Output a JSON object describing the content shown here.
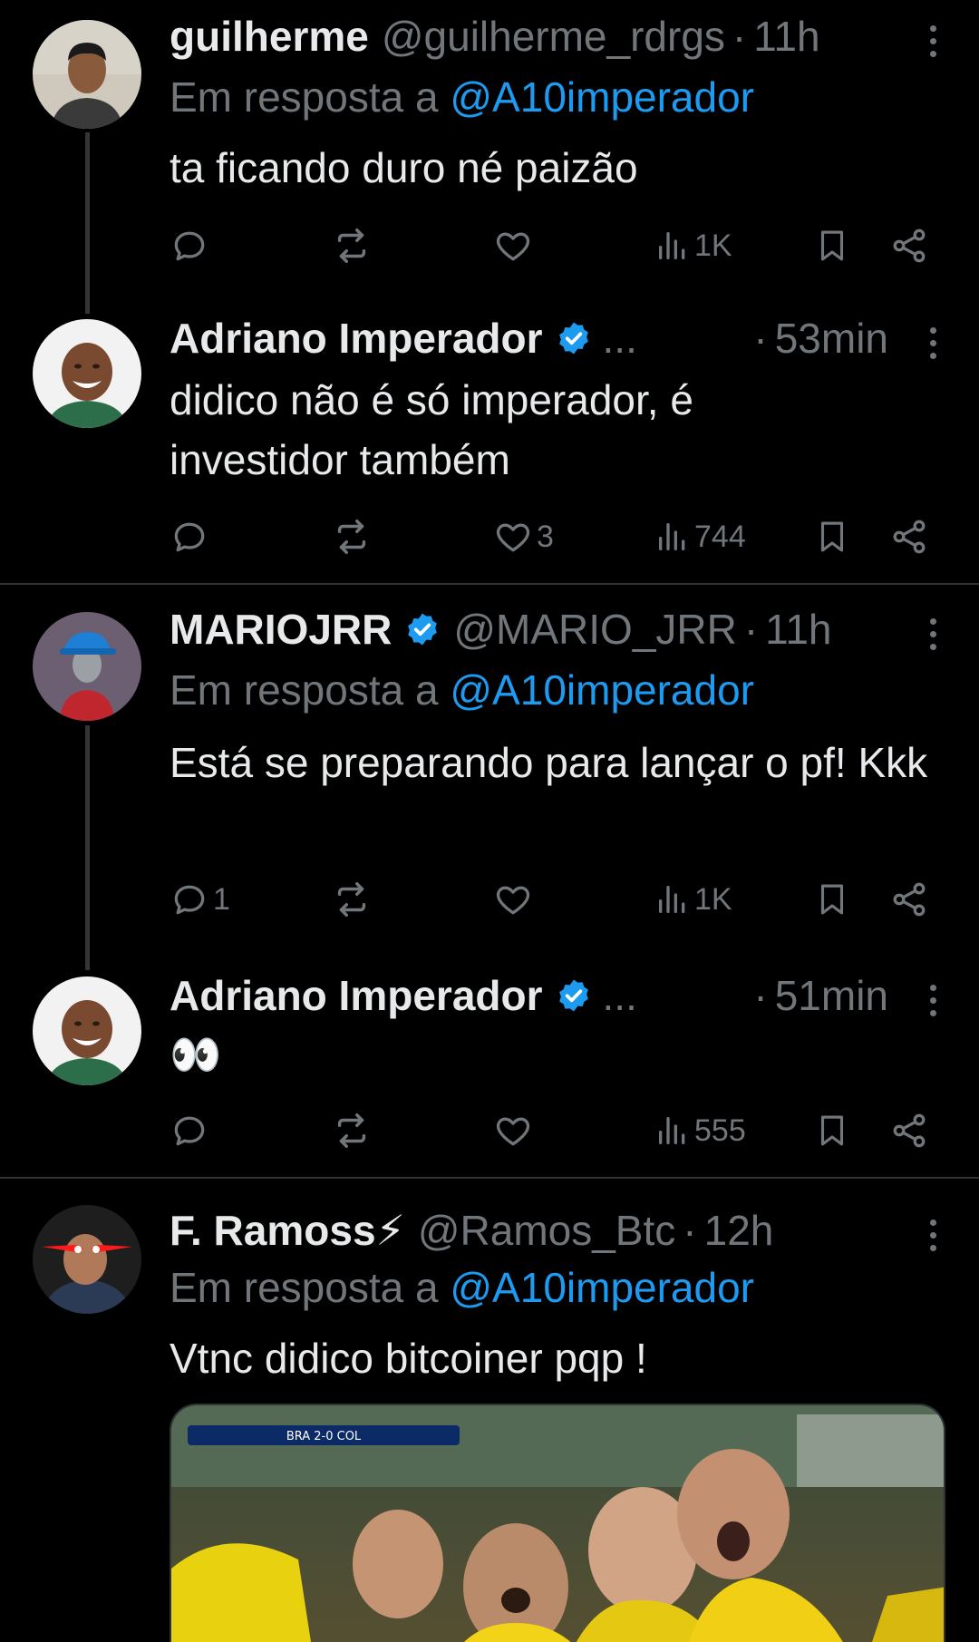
{
  "tweets": [
    {
      "name": "guilherme",
      "handle": "@guilherme_rdrgs",
      "time": "11h",
      "reply_prefix": "Em resposta a",
      "reply_mention": "@A10imperador",
      "text": "ta ficando duro né paizão",
      "counts": {
        "reply": "",
        "repost": "",
        "like": "",
        "views": "1K"
      }
    },
    {
      "name": "Adriano Imperador",
      "verified": true,
      "ellipsis": "...",
      "time": "53min",
      "text": "didico não é só imperador, é investidor também",
      "counts": {
        "reply": "",
        "repost": "",
        "like": "3",
        "views": "744"
      }
    },
    {
      "name": "MARIOJRR",
      "verified": true,
      "handle": "@MARIO_JRR",
      "time": "11h",
      "reply_prefix": "Em resposta a",
      "reply_mention": "@A10imperador",
      "text": "Está se preparando para lançar o pf! Kkk",
      "counts": {
        "reply": "1",
        "repost": "",
        "like": "",
        "views": "1K"
      }
    },
    {
      "name": "Adriano Imperador",
      "verified": true,
      "ellipsis": "...",
      "time": "51min",
      "text": "👀",
      "counts": {
        "reply": "",
        "repost": "",
        "like": "",
        "views": "555"
      }
    },
    {
      "name": "F. Ramoss⚡",
      "handle": "@Ramos_Btc",
      "time": "12h",
      "reply_prefix": "Em resposta a",
      "reply_mention": "@A10imperador",
      "text": "Vtnc didico bitcoiner pqp !",
      "media_overlay": "BRA 2-0 COL"
    }
  ],
  "colors": {
    "background": "#000000",
    "text": "#e7e9ea",
    "muted": "#71767b",
    "link": "#1d9bf0",
    "verified": "#1d9bf0",
    "divider": "#2f3336"
  },
  "icons": [
    "reply-icon",
    "repost-icon",
    "like-icon",
    "views-icon",
    "bookmark-icon",
    "share-icon",
    "more-icon",
    "verified-badge-icon"
  ]
}
